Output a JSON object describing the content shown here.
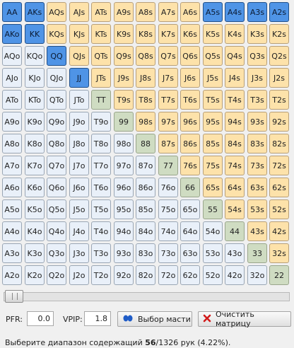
{
  "matrix": {
    "rows": [
      [
        {
          "t": "AA",
          "s": "sel"
        },
        {
          "t": "AKs",
          "s": "sel"
        },
        {
          "t": "AQs",
          "s": "suited"
        },
        {
          "t": "AJs",
          "s": "suited"
        },
        {
          "t": "ATs",
          "s": "suited"
        },
        {
          "t": "A9s",
          "s": "suited"
        },
        {
          "t": "A8s",
          "s": "suited"
        },
        {
          "t": "A7s",
          "s": "suited"
        },
        {
          "t": "A6s",
          "s": "suited"
        },
        {
          "t": "A5s",
          "s": "sel"
        },
        {
          "t": "A4s",
          "s": "sel"
        },
        {
          "t": "A3s",
          "s": "sel"
        },
        {
          "t": "A2s",
          "s": "sel"
        }
      ],
      [
        {
          "t": "AKo",
          "s": "sel"
        },
        {
          "t": "KK",
          "s": "sel"
        },
        {
          "t": "KQs",
          "s": "suited"
        },
        {
          "t": "KJs",
          "s": "suited"
        },
        {
          "t": "KTs",
          "s": "suited"
        },
        {
          "t": "K9s",
          "s": "suited"
        },
        {
          "t": "K8s",
          "s": "suited"
        },
        {
          "t": "K7s",
          "s": "suited"
        },
        {
          "t": "K6s",
          "s": "suited"
        },
        {
          "t": "K5s",
          "s": "suited"
        },
        {
          "t": "K4s",
          "s": "suited"
        },
        {
          "t": "K3s",
          "s": "suited"
        },
        {
          "t": "K2s",
          "s": "suited"
        }
      ],
      [
        {
          "t": "AQo",
          "s": "off"
        },
        {
          "t": "KQo",
          "s": "off"
        },
        {
          "t": "QQ",
          "s": "sel"
        },
        {
          "t": "QJs",
          "s": "suited"
        },
        {
          "t": "QTs",
          "s": "suited"
        },
        {
          "t": "Q9s",
          "s": "suited"
        },
        {
          "t": "Q8s",
          "s": "suited"
        },
        {
          "t": "Q7s",
          "s": "suited"
        },
        {
          "t": "Q6s",
          "s": "suited"
        },
        {
          "t": "Q5s",
          "s": "suited"
        },
        {
          "t": "Q4s",
          "s": "suited"
        },
        {
          "t": "Q3s",
          "s": "suited"
        },
        {
          "t": "Q2s",
          "s": "suited"
        }
      ],
      [
        {
          "t": "AJo",
          "s": "off"
        },
        {
          "t": "KJo",
          "s": "off"
        },
        {
          "t": "QJo",
          "s": "off"
        },
        {
          "t": "JJ",
          "s": "sel"
        },
        {
          "t": "JTs",
          "s": "suited"
        },
        {
          "t": "J9s",
          "s": "suited"
        },
        {
          "t": "J8s",
          "s": "suited"
        },
        {
          "t": "J7s",
          "s": "suited"
        },
        {
          "t": "J6s",
          "s": "suited"
        },
        {
          "t": "J5s",
          "s": "suited"
        },
        {
          "t": "J4s",
          "s": "suited"
        },
        {
          "t": "J3s",
          "s": "suited"
        },
        {
          "t": "J2s",
          "s": "suited"
        }
      ],
      [
        {
          "t": "ATo",
          "s": "off"
        },
        {
          "t": "KTo",
          "s": "off"
        },
        {
          "t": "QTo",
          "s": "off"
        },
        {
          "t": "JTo",
          "s": "off"
        },
        {
          "t": "TT",
          "s": "pair"
        },
        {
          "t": "T9s",
          "s": "suited"
        },
        {
          "t": "T8s",
          "s": "suited"
        },
        {
          "t": "T7s",
          "s": "suited"
        },
        {
          "t": "T6s",
          "s": "suited"
        },
        {
          "t": "T5s",
          "s": "suited"
        },
        {
          "t": "T4s",
          "s": "suited"
        },
        {
          "t": "T3s",
          "s": "suited"
        },
        {
          "t": "T2s",
          "s": "suited"
        }
      ],
      [
        {
          "t": "A9o",
          "s": "off"
        },
        {
          "t": "K9o",
          "s": "off"
        },
        {
          "t": "Q9o",
          "s": "off"
        },
        {
          "t": "J9o",
          "s": "off"
        },
        {
          "t": "T9o",
          "s": "off"
        },
        {
          "t": "99",
          "s": "pair"
        },
        {
          "t": "98s",
          "s": "suited"
        },
        {
          "t": "97s",
          "s": "suited"
        },
        {
          "t": "96s",
          "s": "suited"
        },
        {
          "t": "95s",
          "s": "suited"
        },
        {
          "t": "94s",
          "s": "suited"
        },
        {
          "t": "93s",
          "s": "suited"
        },
        {
          "t": "92s",
          "s": "suited"
        }
      ],
      [
        {
          "t": "A8o",
          "s": "off"
        },
        {
          "t": "K8o",
          "s": "off"
        },
        {
          "t": "Q8o",
          "s": "off"
        },
        {
          "t": "J8o",
          "s": "off"
        },
        {
          "t": "T8o",
          "s": "off"
        },
        {
          "t": "98o",
          "s": "off"
        },
        {
          "t": "88",
          "s": "pair"
        },
        {
          "t": "87s",
          "s": "suited"
        },
        {
          "t": "86s",
          "s": "suited"
        },
        {
          "t": "85s",
          "s": "suited"
        },
        {
          "t": "84s",
          "s": "suited"
        },
        {
          "t": "83s",
          "s": "suited"
        },
        {
          "t": "82s",
          "s": "suited"
        }
      ],
      [
        {
          "t": "A7o",
          "s": "off"
        },
        {
          "t": "K7o",
          "s": "off"
        },
        {
          "t": "Q7o",
          "s": "off"
        },
        {
          "t": "J7o",
          "s": "off"
        },
        {
          "t": "T7o",
          "s": "off"
        },
        {
          "t": "97o",
          "s": "off"
        },
        {
          "t": "87o",
          "s": "off"
        },
        {
          "t": "77",
          "s": "pair"
        },
        {
          "t": "76s",
          "s": "suited"
        },
        {
          "t": "75s",
          "s": "suited"
        },
        {
          "t": "74s",
          "s": "suited"
        },
        {
          "t": "73s",
          "s": "suited"
        },
        {
          "t": "72s",
          "s": "suited"
        }
      ],
      [
        {
          "t": "A6o",
          "s": "off"
        },
        {
          "t": "K6o",
          "s": "off"
        },
        {
          "t": "Q6o",
          "s": "off"
        },
        {
          "t": "J6o",
          "s": "off"
        },
        {
          "t": "T6o",
          "s": "off"
        },
        {
          "t": "96o",
          "s": "off"
        },
        {
          "t": "86o",
          "s": "off"
        },
        {
          "t": "76o",
          "s": "off"
        },
        {
          "t": "66",
          "s": "pair"
        },
        {
          "t": "65s",
          "s": "suited"
        },
        {
          "t": "64s",
          "s": "suited"
        },
        {
          "t": "63s",
          "s": "suited"
        },
        {
          "t": "62s",
          "s": "suited"
        }
      ],
      [
        {
          "t": "A5o",
          "s": "off"
        },
        {
          "t": "K5o",
          "s": "off"
        },
        {
          "t": "Q5o",
          "s": "off"
        },
        {
          "t": "J5o",
          "s": "off"
        },
        {
          "t": "T5o",
          "s": "off"
        },
        {
          "t": "95o",
          "s": "off"
        },
        {
          "t": "85o",
          "s": "off"
        },
        {
          "t": "75o",
          "s": "off"
        },
        {
          "t": "65o",
          "s": "off"
        },
        {
          "t": "55",
          "s": "pair"
        },
        {
          "t": "54s",
          "s": "suited"
        },
        {
          "t": "53s",
          "s": "suited"
        },
        {
          "t": "52s",
          "s": "suited"
        }
      ],
      [
        {
          "t": "A4o",
          "s": "off"
        },
        {
          "t": "K4o",
          "s": "off"
        },
        {
          "t": "Q4o",
          "s": "off"
        },
        {
          "t": "J4o",
          "s": "off"
        },
        {
          "t": "T4o",
          "s": "off"
        },
        {
          "t": "94o",
          "s": "off"
        },
        {
          "t": "84o",
          "s": "off"
        },
        {
          "t": "74o",
          "s": "off"
        },
        {
          "t": "64o",
          "s": "off"
        },
        {
          "t": "54o",
          "s": "off"
        },
        {
          "t": "44",
          "s": "pair"
        },
        {
          "t": "43s",
          "s": "suited"
        },
        {
          "t": "42s",
          "s": "suited"
        }
      ],
      [
        {
          "t": "A3o",
          "s": "off"
        },
        {
          "t": "K3o",
          "s": "off"
        },
        {
          "t": "Q3o",
          "s": "off"
        },
        {
          "t": "J3o",
          "s": "off"
        },
        {
          "t": "T3o",
          "s": "off"
        },
        {
          "t": "93o",
          "s": "off"
        },
        {
          "t": "83o",
          "s": "off"
        },
        {
          "t": "73o",
          "s": "off"
        },
        {
          "t": "63o",
          "s": "off"
        },
        {
          "t": "53o",
          "s": "off"
        },
        {
          "t": "43o",
          "s": "off"
        },
        {
          "t": "33",
          "s": "pair"
        },
        {
          "t": "32s",
          "s": "suited"
        }
      ],
      [
        {
          "t": "A2o",
          "s": "off"
        },
        {
          "t": "K2o",
          "s": "off"
        },
        {
          "t": "Q2o",
          "s": "off"
        },
        {
          "t": "J2o",
          "s": "off"
        },
        {
          "t": "T2o",
          "s": "off"
        },
        {
          "t": "92o",
          "s": "off"
        },
        {
          "t": "82o",
          "s": "off"
        },
        {
          "t": "72o",
          "s": "off"
        },
        {
          "t": "62o",
          "s": "off"
        },
        {
          "t": "52o",
          "s": "off"
        },
        {
          "t": "42o",
          "s": "off"
        },
        {
          "t": "32o",
          "s": "off"
        },
        {
          "t": "22",
          "s": "pair"
        }
      ]
    ]
  },
  "slider": {
    "value_percent": 0
  },
  "controls": {
    "pfr_label": "PFR:",
    "pfr_value": "0.0",
    "vpip_label": "VPIP:",
    "vpip_value": "1.8",
    "suit_button_label": "Выбор масти",
    "clear_button_label": "Очистить матрицу"
  },
  "status": {
    "prefix": "Выберите диапазон содержащий ",
    "combos_selected": "56",
    "combos_total": "/1326 рук (4.22%)."
  },
  "colors": {
    "selected": "#4f94e6",
    "suited": "#fde2aa",
    "offsuit": "#e9f0f9",
    "pair": "#cfdcc2",
    "clear_icon": "#d11a1a",
    "suit_icon": "#1f5cc7"
  }
}
